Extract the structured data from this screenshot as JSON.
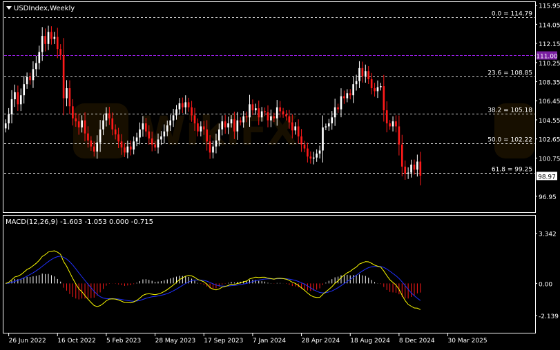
{
  "window": {
    "symbol_label": "USDIndex,Weekly",
    "menu_arrow_icon": "triangle-down-icon"
  },
  "colors": {
    "background": "#000000",
    "frame": "#ffffff",
    "bull": "#ffffff",
    "bear": "#ff1a1a",
    "grid": "#c8c8c8",
    "fib_line": "#d8d8d8",
    "level_line": "#a020f0",
    "macd_line": "#ffff00",
    "signal_line": "#2030ff",
    "hist_pos": "#ffffff",
    "hist_neg": "#ff1a1a",
    "text": "#ffffff",
    "price_tag_bg": "#ffffff",
    "price_tag_text": "#000000",
    "level_tag_bg": "#7a1fa2",
    "watermark": "#2a1c00"
  },
  "watermark": {
    "text": "WikiFX"
  },
  "chart_data": [
    {
      "type": "candlestick",
      "title": "USDIndex,Weekly",
      "ylim": [
        95.5,
        116.2
      ],
      "price_ticks": [
        "115.95",
        "114.05",
        "112.15",
        "110.25",
        "108.35",
        "106.45",
        "104.55",
        "102.65",
        "100.75",
        "96.95"
      ],
      "price_tick_values": [
        115.95,
        114.05,
        112.15,
        110.25,
        108.35,
        106.45,
        104.55,
        102.65,
        100.75,
        96.95
      ],
      "current_price": {
        "label": "98.97",
        "value": 98.97
      },
      "level_line": {
        "label": "111.00",
        "value": 111.0
      },
      "fibonacci": [
        {
          "label": "0.0 = 114.79",
          "value": 114.79
        },
        {
          "label": "23.6 = 108.85",
          "value": 108.85
        },
        {
          "label": "38.2 = 105.18",
          "value": 105.18
        },
        {
          "label": "50.0 = 102.22",
          "value": 102.22
        },
        {
          "label": "61.8 = 99.25",
          "value": 99.25
        }
      ],
      "time_labels": [
        "26 Jun 2022",
        "16 Oct 2022",
        "5 Feb 2023",
        "28 May 2023",
        "17 Sep 2023",
        "7 Jan 2024",
        "28 Apr 2024",
        "18 Aug 2024",
        "8 Dec 2024",
        "30 Mar 2025"
      ],
      "time_label_bar_index": [
        1,
        17,
        33,
        49,
        65,
        81,
        97,
        113,
        129,
        145
      ],
      "closes": [
        104.2,
        105.1,
        106.6,
        107.3,
        106.1,
        107.0,
        108.1,
        108.8,
        108.5,
        109.6,
        110.2,
        111.3,
        112.9,
        112.1,
        113.3,
        112.6,
        112.8,
        111.6,
        111.0,
        106.7,
        107.7,
        105.9,
        104.7,
        104.4,
        103.8,
        104.5,
        103.2,
        102.5,
        101.9,
        101.4,
        102.3,
        103.6,
        104.5,
        105.2,
        104.7,
        103.6,
        103.1,
        102.4,
        101.8,
        101.3,
        101.9,
        101.6,
        102.4,
        102.8,
        103.6,
        104.2,
        103.4,
        102.7,
        102.1,
        101.8,
        102.6,
        102.9,
        103.4,
        104.0,
        104.5,
        105.0,
        105.6,
        106.2,
        105.8,
        106.3,
        105.8,
        105.0,
        104.2,
        103.4,
        103.9,
        103.6,
        102.4,
        101.3,
        101.9,
        102.5,
        103.6,
        104.4,
        103.8,
        104.2,
        104.6,
        103.4,
        104.5,
        104.3,
        104.9,
        104.8,
        106.1,
        105.5,
        105.7,
        104.8,
        105.4,
        105.3,
        104.5,
        104.9,
        104.7,
        105.8,
        105.4,
        105.1,
        104.9,
        104.3,
        103.5,
        103.9,
        102.9,
        102.1,
        101.7,
        100.9,
        100.7,
        100.8,
        101.2,
        101.5,
        103.8,
        103.9,
        104.2,
        104.8,
        105.8,
        105.6,
        106.9,
        106.7,
        107.2,
        107.0,
        108.1,
        108.4,
        109.7,
        108.9,
        109.4,
        108.6,
        107.7,
        107.4,
        107.8,
        107.9,
        105.5,
        104.2,
        103.9,
        104.4,
        103.9,
        102.1,
        99.9,
        99.2,
        99.3,
        100.1,
        99.6,
        100.4,
        99.0
      ],
      "xlabel": "",
      "ylabel": ""
    },
    {
      "type": "macd",
      "label": "MACD(12,26,9) -1.603 -1.053 0.000 -0.715",
      "ylim": [
        -2.6,
        3.6
      ],
      "ticks": [
        "3.342",
        "0.00",
        "-2.139"
      ],
      "tick_values": [
        3.342,
        0.0,
        -2.139
      ],
      "xlabel": "",
      "ylabel": ""
    }
  ]
}
